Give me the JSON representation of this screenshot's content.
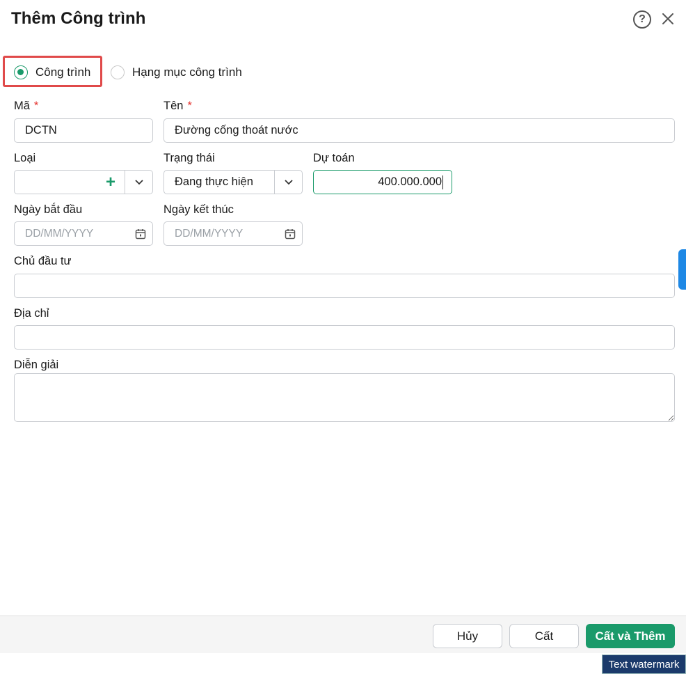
{
  "dialog": {
    "title": "Thêm Công trình"
  },
  "type_options": {
    "cong_trinh": "Công trình",
    "hang_muc": "Hạng mục công trình",
    "selected": "cong_trinh"
  },
  "form": {
    "ma": {
      "label": "Mã",
      "required_mark": "*",
      "value": "DCTN"
    },
    "ten": {
      "label": "Tên",
      "required_mark": "*",
      "value": "Đường cống thoát nước"
    },
    "loai": {
      "label": "Loại",
      "value": ""
    },
    "trang_thai": {
      "label": "Trạng thái",
      "value": "Đang thực hiện"
    },
    "du_toan": {
      "label": "Dự toán",
      "value": "400.000.000"
    },
    "ngay_bat_dau": {
      "label": "Ngày bắt đầu",
      "placeholder": "DD/MM/YYYY"
    },
    "ngay_ket_thuc": {
      "label": "Ngày kết thúc",
      "placeholder": "DD/MM/YYYY"
    },
    "chu_dau_tu": {
      "label": "Chủ đầu tư",
      "value": ""
    },
    "dia_chi": {
      "label": "Địa chỉ",
      "value": ""
    },
    "dien_giai": {
      "label": "Diễn giải",
      "value": ""
    }
  },
  "footer": {
    "cancel": "Hủy",
    "save": "Cất",
    "save_and_add": "Cất và Thêm"
  },
  "watermark": "Text watermark",
  "colors": {
    "accent": "#1a9a6a",
    "required": "#e53935",
    "highlight": "#e04a4a",
    "side_tab": "#1e88e5"
  }
}
